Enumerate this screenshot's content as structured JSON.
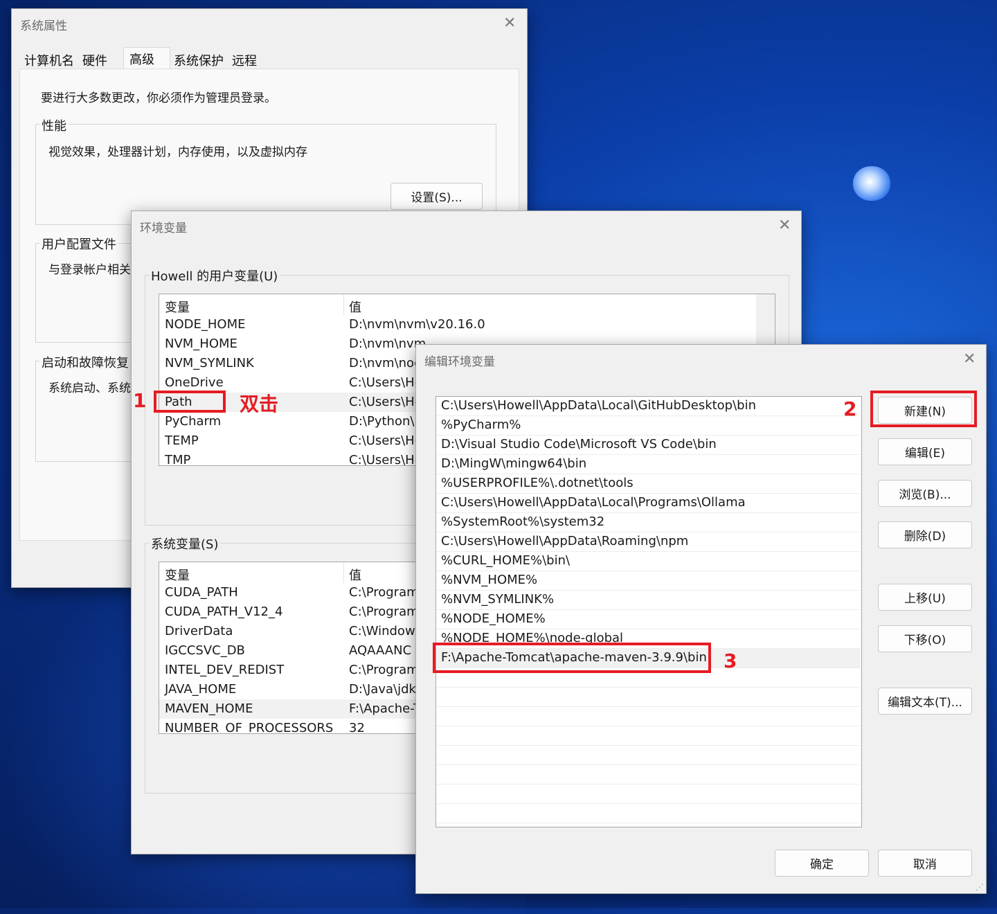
{
  "sys_props": {
    "title": "系统属性",
    "tabs": [
      "计算机名",
      "硬件",
      "高级",
      "系统保护",
      "远程"
    ],
    "admin_note": "要进行大多数更改，你必须作为管理员登录。",
    "perf_label": "性能",
    "perf_desc": "视觉效果，处理器计划，内存使用，以及虚拟内存",
    "settings_button": "设置(S)...",
    "profile_label": "用户配置文件",
    "profile_desc": "与登录帐户相关",
    "startup_label": "启动和故障恢复",
    "startup_desc": "系统启动、系统"
  },
  "env_vars": {
    "title": "环境变量",
    "user_group_label": "Howell 的用户变量(U)",
    "user_columns": [
      "变量",
      "值"
    ],
    "user_rows": [
      {
        "name": "NODE_HOME",
        "value": "D:\\nvm\\nvm\\v20.16.0"
      },
      {
        "name": "NVM_HOME",
        "value": "D:\\nvm\\nvm"
      },
      {
        "name": "NVM_SYMLINK",
        "value": "D:\\nvm\\nod"
      },
      {
        "name": "OneDrive",
        "value": "C:\\Users\\Ho"
      },
      {
        "name": "Path",
        "value": "C:\\Users\\Ho"
      },
      {
        "name": "PyCharm",
        "value": "D:\\Python\\P"
      },
      {
        "name": "TEMP",
        "value": "C:\\Users\\Ho"
      },
      {
        "name": "TMP",
        "value": "C:\\Users\\Ho"
      }
    ],
    "sys_group_label": "系统变量(S)",
    "sys_columns": [
      "变量",
      "值"
    ],
    "sys_rows": [
      {
        "name": "CUDA_PATH",
        "value": "C:\\Program"
      },
      {
        "name": "CUDA_PATH_V12_4",
        "value": "C:\\Program"
      },
      {
        "name": "DriverData",
        "value": "C:\\Windows"
      },
      {
        "name": "IGCCSVC_DB",
        "value": "AQAAANC"
      },
      {
        "name": "INTEL_DEV_REDIST",
        "value": "C:\\Program"
      },
      {
        "name": "JAVA_HOME",
        "value": "D:\\Java\\jdk"
      },
      {
        "name": "MAVEN_HOME",
        "value": "F:\\Apache-T"
      },
      {
        "name": "NUMBER_OF_PROCESSORS",
        "value": "32"
      }
    ]
  },
  "edit_env": {
    "title": "编辑环境变量",
    "entries": [
      "C:\\Users\\Howell\\AppData\\Local\\GitHubDesktop\\bin",
      "%PyCharm%",
      "D:\\Visual Studio Code\\Microsoft VS Code\\bin",
      "D:\\MingW\\mingw64\\bin",
      "%USERPROFILE%\\.dotnet\\tools",
      "C:\\Users\\Howell\\AppData\\Local\\Programs\\Ollama",
      "%SystemRoot%\\system32",
      "C:\\Users\\Howell\\AppData\\Roaming\\npm",
      "%CURL_HOME%\\bin\\",
      "%NVM_HOME%",
      "%NVM_SYMLINK%",
      "%NODE_HOME%",
      "%NODE_HOME%\\node-global",
      "F:\\Apache-Tomcat\\apache-maven-3.9.9\\bin"
    ],
    "buttons": {
      "new": "新建(N)",
      "edit": "编辑(E)",
      "browse": "浏览(B)...",
      "delete": "删除(D)",
      "move_up": "上移(U)",
      "move_down": "下移(O)",
      "edit_text": "编辑文本(T)...",
      "ok": "确定",
      "cancel": "取消"
    }
  },
  "annotations": {
    "step1": "1",
    "step1_text": "双击",
    "step2": "2",
    "step3": "3",
    "color": "#e51c23"
  }
}
